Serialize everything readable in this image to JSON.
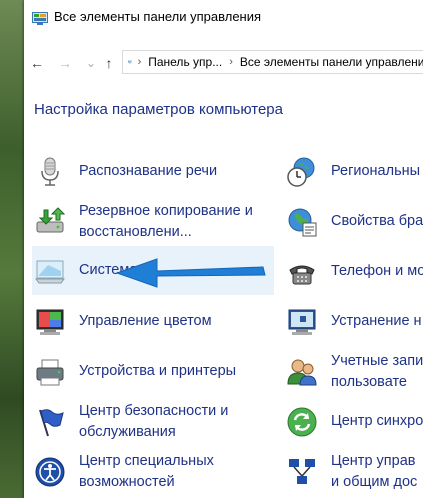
{
  "window": {
    "title": "Все элементы панели управления"
  },
  "nav": {
    "back": "←",
    "forward": "→",
    "up": "↑",
    "breadcrumbs": [
      "Панель упр...",
      "Все элементы панели управления"
    ]
  },
  "main": {
    "heading": "Настройка параметров компьютера",
    "left_items": [
      {
        "line1": "Распознавание речи",
        "line2": "",
        "icon": "microphone-icon"
      },
      {
        "line1": "Резервное копирование и",
        "line2": "восстановлени...",
        "icon": "backup-restore-icon"
      },
      {
        "line1": "Система",
        "line2": "",
        "icon": "system-monitor-icon"
      },
      {
        "line1": "Управление цветом",
        "line2": "",
        "icon": "color-management-icon"
      },
      {
        "line1": "Устройства и принтеры",
        "line2": "",
        "icon": "printer-icon"
      },
      {
        "line1": "Центр безопасности и",
        "line2": "обслуживания",
        "icon": "security-flag-icon"
      },
      {
        "line1": "Центр специальных",
        "line2": "возможностей",
        "icon": "accessibility-icon"
      }
    ],
    "right_items": [
      {
        "line1": "Региональны",
        "line2": "",
        "icon": "region-clock-icon"
      },
      {
        "line1": "Свойства бра",
        "line2": "",
        "icon": "browser-properties-icon"
      },
      {
        "line1": "Телефон и мо",
        "line2": "",
        "icon": "phone-modem-icon"
      },
      {
        "line1": "Устранение н",
        "line2": "",
        "icon": "troubleshooting-icon"
      },
      {
        "line1": "Учетные запи",
        "line2": "пользовате",
        "icon": "user-accounts-icon"
      },
      {
        "line1": "Центр синхро",
        "line2": "",
        "icon": "sync-center-icon"
      },
      {
        "line1": "Центр управ",
        "line2": "и общим дос",
        "icon": "network-center-icon"
      }
    ]
  },
  "colors": {
    "link": "#1e3287",
    "selected_bg": "#e8f2fb",
    "arrow": "#1f7fd6"
  }
}
